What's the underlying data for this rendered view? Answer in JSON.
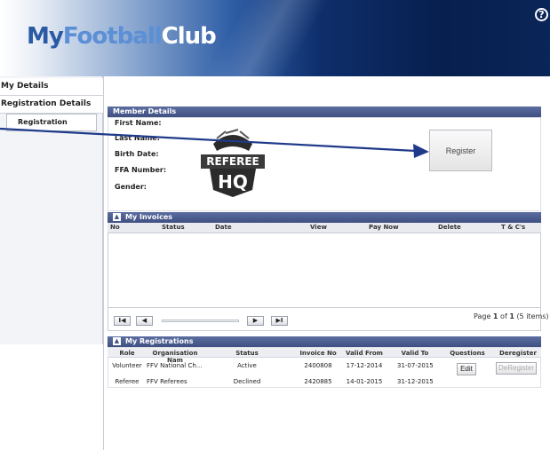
{
  "logo": {
    "part1": "My",
    "part2": "Football",
    "part3": "Club"
  },
  "help_glyph": "?",
  "sidebar": {
    "items": [
      "My Details",
      "Registration Details"
    ],
    "sub_item": "Registration"
  },
  "member_details": {
    "title": "Member Details",
    "labels": [
      "First Name:",
      "Last Name:",
      "Birth Date:",
      "FFA Number:",
      "Gender:"
    ],
    "register_button": "Register",
    "badge_line1": "REFEREE",
    "badge_line2": "HQ"
  },
  "invoices": {
    "title": "My Invoices",
    "columns": [
      "No",
      "Status",
      "Date",
      "View",
      "Pay Now",
      "Delete",
      "T & C's"
    ],
    "pager": {
      "first": "I◀",
      "prev": "◀",
      "next": "▶",
      "last": "▶I",
      "info_prefix": "Page",
      "page": "1",
      "of": "of",
      "pages": "1",
      "items": "(5 items)"
    }
  },
  "registrations": {
    "title": "My Registrations",
    "columns": [
      "Role",
      "Organisation Nam",
      "Status",
      "Invoice No",
      "Valid From",
      "Valid To",
      "Questions",
      "Deregister"
    ],
    "rows": [
      {
        "role": "Volunteer",
        "org": "FFV National Ch...",
        "status": "Active",
        "invoice": "2400808",
        "from": "17-12-2014",
        "to": "31-07-2015",
        "questions": "Edit",
        "deregister": "DeRegister"
      },
      {
        "role": "Referee",
        "org": "FFV Referees",
        "status": "Declined",
        "invoice": "2420885",
        "from": "14-01-2015",
        "to": "31-12-2015",
        "questions": "",
        "deregister": ""
      }
    ]
  },
  "colors": {
    "panel_bar": "#4a5b8e",
    "header_dark": "#0a2558",
    "arrow": "#1f3a8a"
  }
}
